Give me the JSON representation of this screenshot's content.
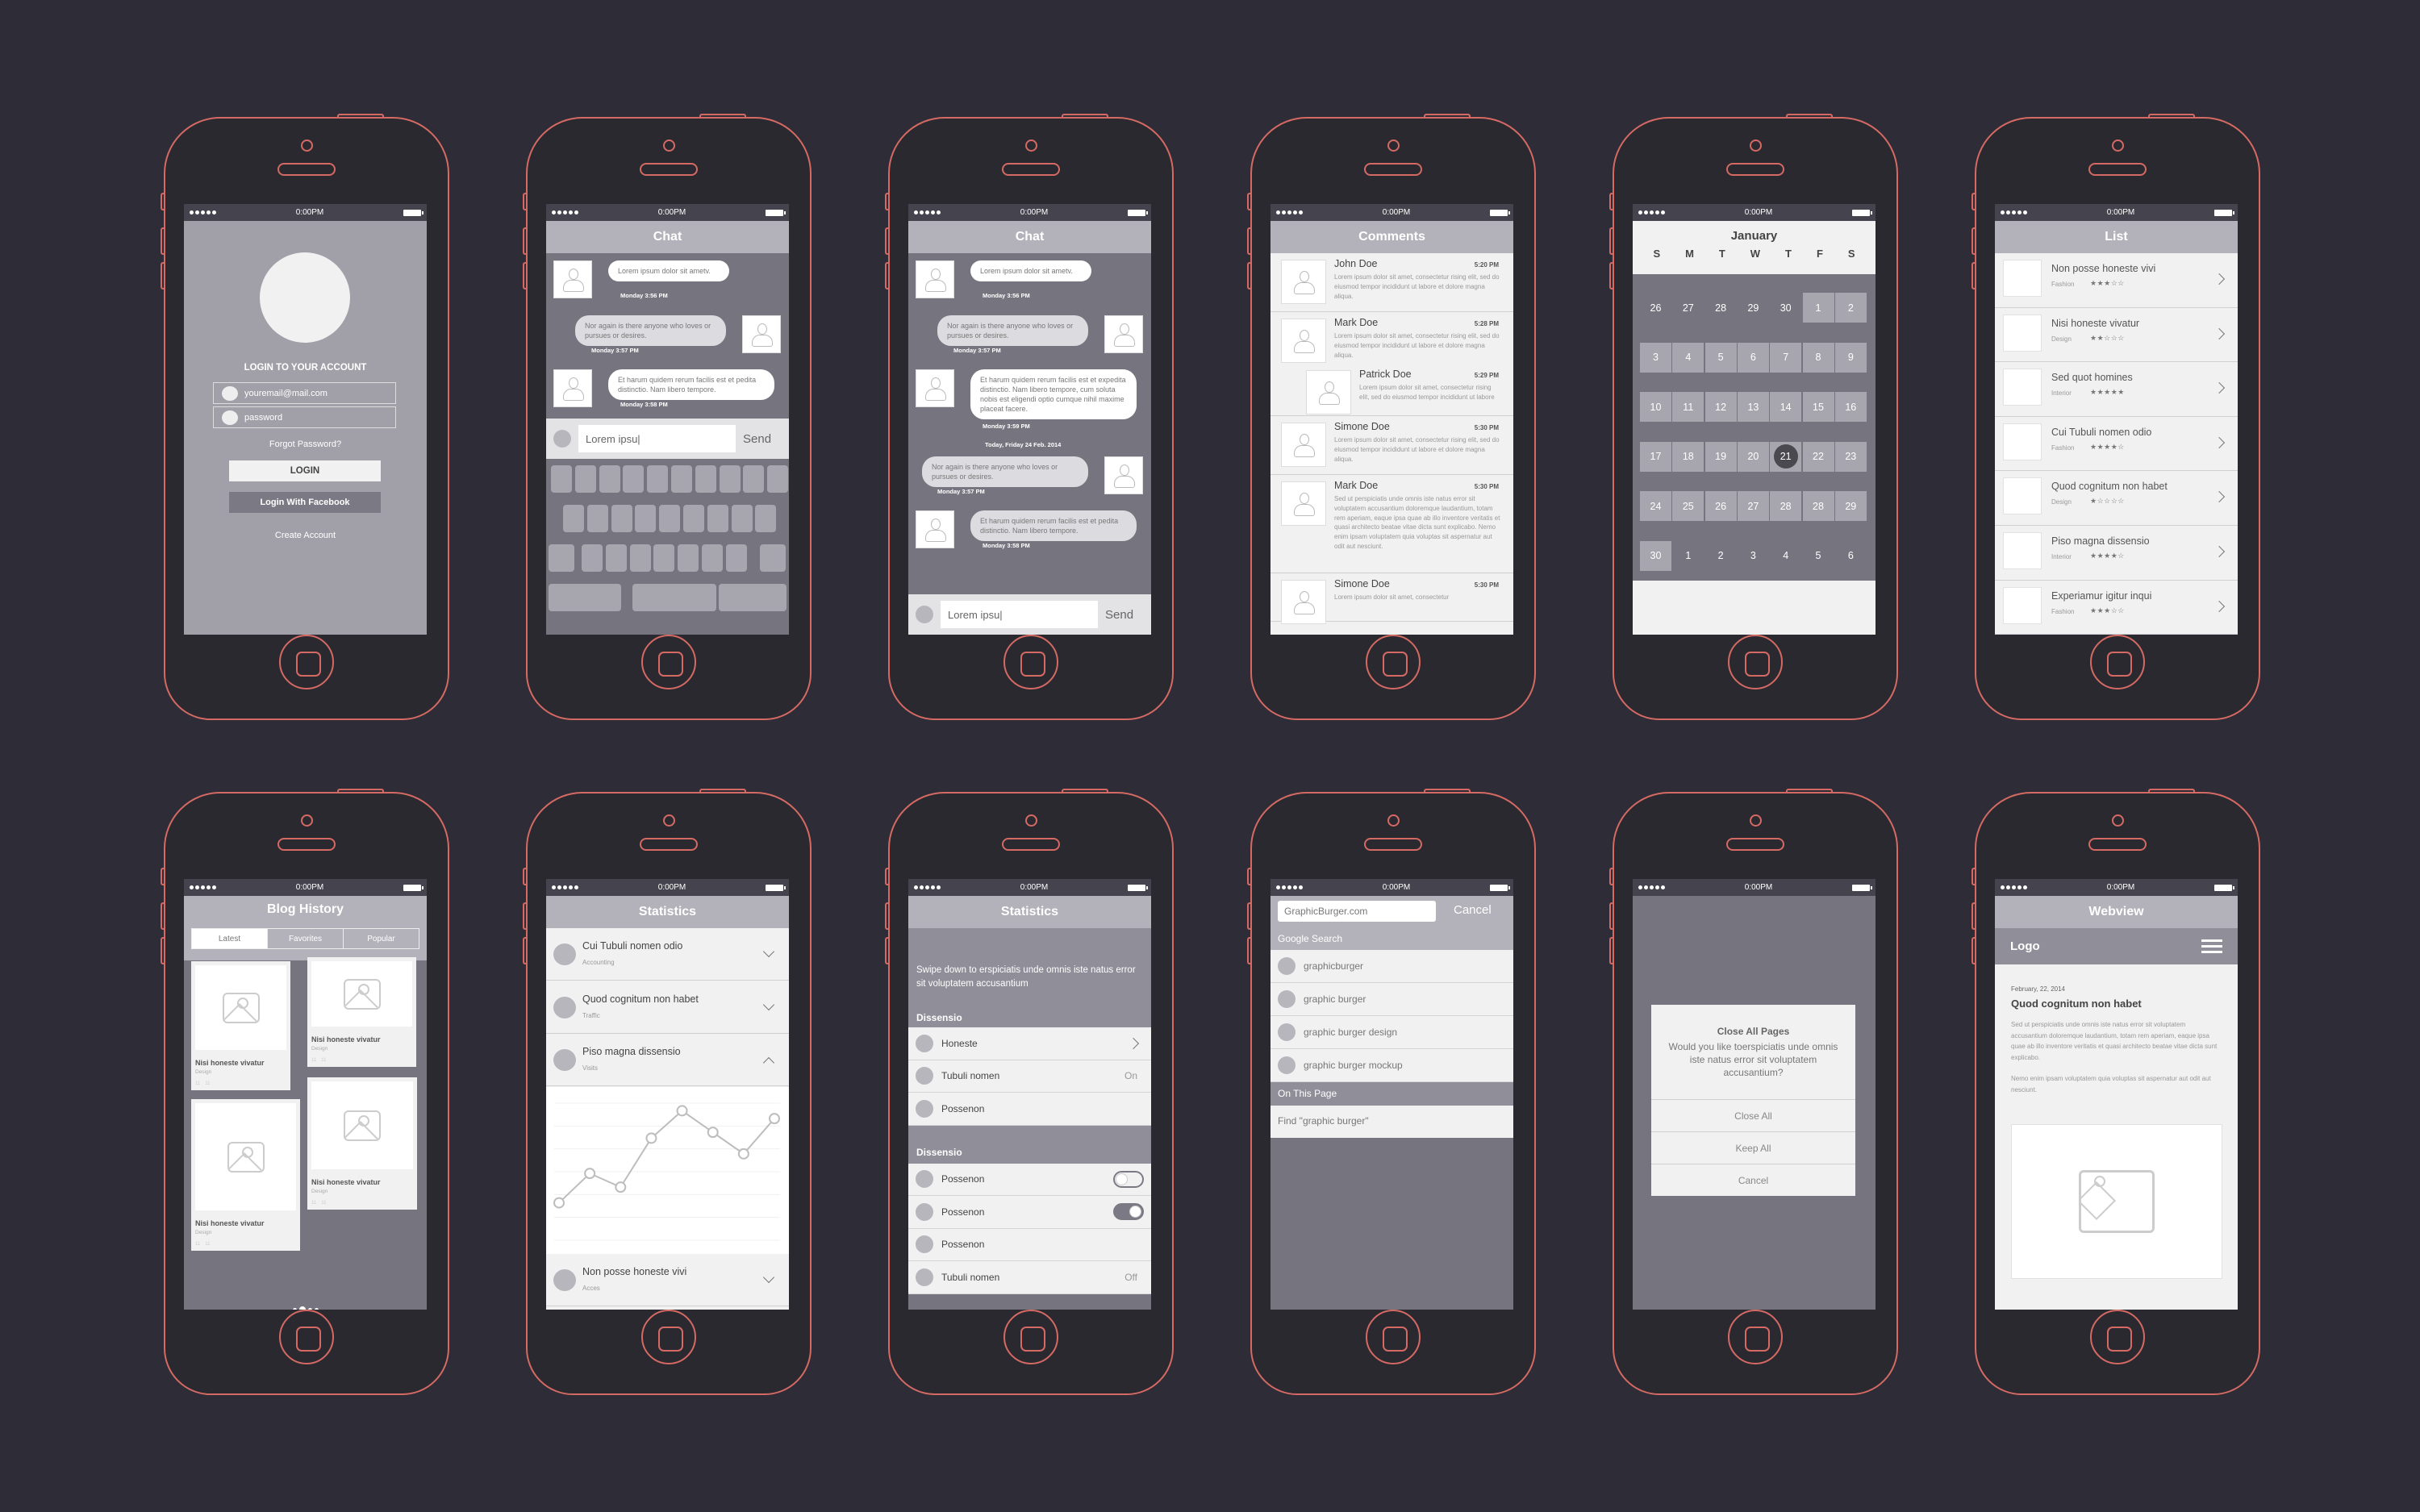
{
  "status_bar": {
    "time": "0:00PM"
  },
  "login": {
    "title": "LOGIN TO YOUR ACCOUNT",
    "email_placeholder": "youremail@mail.com",
    "password_placeholder": "password",
    "forgot": "Forgot Password?",
    "login_btn": "LOGIN",
    "facebook_btn": "Login With Facebook",
    "create": "Create Account"
  },
  "chat1": {
    "title": "Chat",
    "messages": [
      {
        "text": "Lorem ipsum dolor sit ametv.",
        "time": "Monday 3:56 PM",
        "side": "left"
      },
      {
        "text": "Nor again is there anyone who loves or pursues or desires.",
        "time": "Monday 3:57 PM",
        "side": "right"
      },
      {
        "text": "Et harum quidem rerum facilis est et pedita distinctio. Nam libero tempore.",
        "time": "Monday 3:58 PM",
        "side": "left"
      }
    ],
    "input_value": "Lorem ipsu|",
    "send": "Send"
  },
  "chat2": {
    "title": "Chat",
    "messages": [
      {
        "text": "Lorem ipsum dolor sit ametv.",
        "time": "Monday 3:56 PM"
      },
      {
        "text": "Nor again is there anyone who loves or pursues or desires.",
        "time": "Monday 3:57 PM"
      },
      {
        "text": "Et harum quidem rerum facilis est et expedita distinctio. Nam libero tempore, cum soluta nobis est eligendi optio cumque nihil maxime placeat facere.",
        "time": "Monday 3:59 PM"
      },
      {
        "text": "Nor again is there anyone who loves or pursues or desires.",
        "time": "Monday 3:57 PM"
      },
      {
        "text": "Et harum quidem rerum facilis est et pedita distinctio. Nam libero tempore.",
        "time": "Monday 3:58 PM"
      }
    ],
    "date_divider": "Today, Friday 24 Feb. 2014",
    "input_value": "Lorem ipsu|",
    "send": "Send"
  },
  "comments": {
    "title": "Comments",
    "items": [
      {
        "name": "John Doe",
        "time": "5:20 PM",
        "text": "Lorem ipsum dolor sit amet, consectetur rising elit, sed do eiusmod tempor incididunt ut labore et dolore magna aliqua."
      },
      {
        "name": "Mark Doe",
        "time": "5:28 PM",
        "text": "Lorem ipsum dolor sit amet, consectetur rising elit, sed do eiusmod tempor incididunt ut labore et dolore magna aliqua."
      },
      {
        "name": "Patrick Doe",
        "time": "5:29 PM",
        "text": "Lorem ipsum dolor sit amet, consectetur rising elit, sed do eiusmod tempor incididunt ut labore"
      },
      {
        "name": "Simone Doe",
        "time": "5:30 PM",
        "text": "Lorem ipsum dolor sit amet, consectetur rising elit, sed do eiusmod tempor incididunt ut labore et dolore magna aliqua."
      },
      {
        "name": "Mark Doe",
        "time": "5:30 PM",
        "text": "Sed ut perspiciatis unde omnis iste natus error sit voluptatem accusantium doloremque laudantium, totam rem aperiam, eaque ipsa quae ab illo inventore veritatis et quasi architecto beatae vitae dicta sunt explicabo. Nemo enim ipsam voluptatem quia voluptas sit aspernatur aut odit aut nesciunt."
      },
      {
        "name": "Simone Doe",
        "time": "5:30 PM",
        "text": "Lorem ipsum dolor sit amet, consectetur"
      }
    ]
  },
  "calendar": {
    "month": "January",
    "weekdays": [
      "S",
      "M",
      "T",
      "W",
      "T",
      "F",
      "S"
    ],
    "weeks": [
      [
        "26",
        "27",
        "28",
        "29",
        "30",
        "1",
        "2"
      ],
      [
        "3",
        "4",
        "5",
        "6",
        "7",
        "8",
        "9"
      ],
      [
        "10",
        "11",
        "12",
        "13",
        "14",
        "15",
        "16"
      ],
      [
        "17",
        "18",
        "19",
        "20",
        "21",
        "22",
        "23"
      ],
      [
        "24",
        "25",
        "26",
        "27",
        "28",
        "28",
        "29"
      ],
      [
        "30",
        "1",
        "2",
        "3",
        "4",
        "5",
        "6"
      ]
    ],
    "selected": "21"
  },
  "list": {
    "title": "List",
    "items": [
      {
        "title": "Non posse honeste vivi",
        "category": "Fashion",
        "rating": 3
      },
      {
        "title": "Nisi honeste vivatur",
        "category": "Design",
        "rating": 2
      },
      {
        "title": "Sed quot homines",
        "category": "Interior",
        "rating": 5
      },
      {
        "title": "Cui Tubuli nomen odio",
        "category": "Fashion",
        "rating": 4
      },
      {
        "title": "Quod cognitum non habet",
        "category": "Design",
        "rating": 1
      },
      {
        "title": "Piso magna dissensio",
        "category": "Interior",
        "rating": 4
      },
      {
        "title": "Experiamur igitur inqui",
        "category": "Fashion",
        "rating": 3
      }
    ]
  },
  "blog": {
    "title": "Blog History",
    "tabs": [
      "Latest",
      "Favorites",
      "Popular"
    ],
    "active_tab": "Latest",
    "cards": [
      {
        "title": "Nisi honeste vivatur",
        "category": "Design",
        "likes": "11",
        "comments": "11"
      },
      {
        "title": "Nisi honeste vivatur",
        "category": "Design",
        "likes": "11",
        "comments": "11"
      },
      {
        "title": "Nisi honeste vivatur",
        "category": "Design",
        "likes": "11",
        "comments": "11"
      },
      {
        "title": "Nisi honeste vivatur",
        "category": "Design",
        "likes": "11",
        "comments": "11"
      }
    ],
    "page_index": 2,
    "page_count": 4
  },
  "stats1": {
    "title": "Statistics",
    "items": [
      {
        "title": "Cui Tubuli nomen odio",
        "sub": "Accounting",
        "expanded": false
      },
      {
        "title": "Quod cognitum non habet",
        "sub": "Traffic",
        "expanded": false
      },
      {
        "title": "Piso magna dissensio",
        "sub": "Visits",
        "expanded": true
      },
      {
        "title": "Non posse honeste vivi",
        "sub": "Acces",
        "expanded": false
      }
    ]
  },
  "chart_data": {
    "type": "line",
    "title": "Visits",
    "x": [
      1,
      2,
      3,
      4,
      5,
      6,
      7,
      8
    ],
    "values": [
      1.5,
      3.0,
      2.3,
      4.8,
      6.2,
      5.1,
      4.0,
      5.8
    ],
    "ylim": [
      0,
      7
    ],
    "grid": true,
    "xlabel": "",
    "ylabel": ""
  },
  "stats2": {
    "title": "Statistics",
    "intro": "Swipe down to erspiciatis unde omnis iste natus error sit voluptatem accusantium",
    "section1": "Dissensio",
    "section1_rows": [
      {
        "label": "Honeste",
        "accessory": "chevron"
      },
      {
        "label": "Tubuli nomen",
        "accessory": "On"
      },
      {
        "label": "Possenon",
        "accessory": ""
      }
    ],
    "section2": "Dissensio",
    "section2_rows": [
      {
        "label": "Possenon",
        "accessory": "toggle-off"
      },
      {
        "label": "Possenon",
        "accessory": "toggle-on"
      },
      {
        "label": "Possenon",
        "accessory": ""
      },
      {
        "label": "Tubuli nomen",
        "accessory": "Off"
      }
    ]
  },
  "search": {
    "query": "GraphicBurger.com",
    "cancel": "Cancel",
    "google_header": "Google Search",
    "suggestions": [
      "graphicburger",
      "graphic burger",
      "graphic burger design",
      "graphic burger mockup"
    ],
    "page_header": "On This Page",
    "find": "Find \"graphic burger\""
  },
  "dialog": {
    "title": "Close All Pages",
    "message": "Would you like toerspiciatis unde omnis iste natus error sit voluptatem accusantium?",
    "buttons": [
      "Close All",
      "Keep All",
      "Cancel"
    ]
  },
  "webview": {
    "title": "Webview",
    "logo": "Logo",
    "date": "February, 22, 2014",
    "heading": "Quod cognitum non habet",
    "para1": "Sed ut perspiciatis unde omnis iste natus error sit voluptatem accusantium doloremque laudantium, totam rem aperiam, eaque ipsa quae ab illo inventore veritatis et quasi architecto beatae vitae dicta sunt explicabo.",
    "para2": "Nemo enim ipsam voluptatem quia voluptas sit aspernatur aut odit aut nesciunt."
  },
  "colors": {
    "outline": "#d46a63",
    "background": "#2d2c37",
    "screen_dark": "#76757f",
    "header": "#b3b2ba",
    "light": "#f1f1f2"
  }
}
